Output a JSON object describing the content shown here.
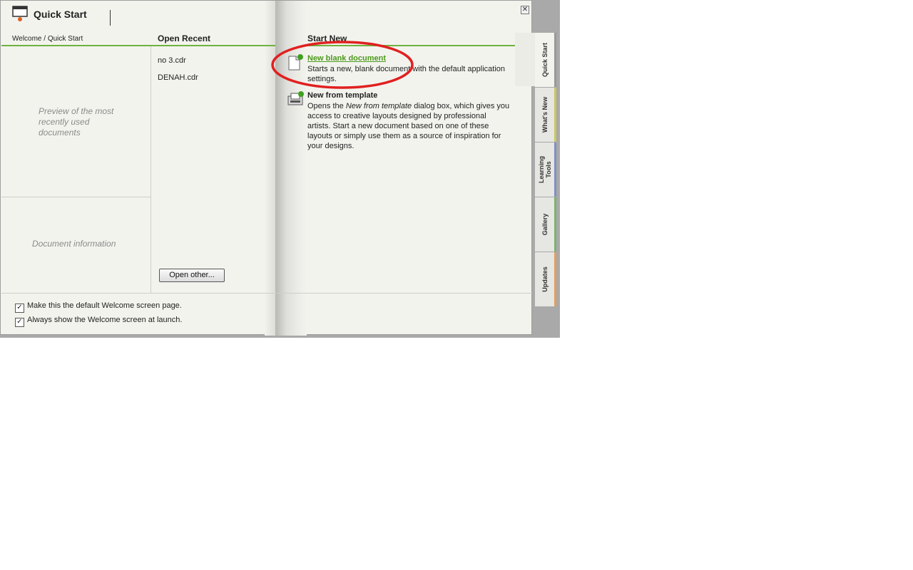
{
  "window": {
    "title": "Quick Start",
    "close_glyph": "✕"
  },
  "breadcrumb": "Welcome / Quick Start",
  "columns": {
    "open_recent": "Open Recent",
    "start_new": "Start New"
  },
  "left_pane": {
    "preview_text": "Preview of the most recently used documents",
    "docinfo_text": "Document information"
  },
  "recent_files": [
    "no 3.cdr",
    "DENAH.cdr"
  ],
  "open_other_label": "Open other...",
  "start_new": {
    "items": [
      {
        "title": "New blank document",
        "description": "Starts a new, blank document with the default application settings.",
        "icon": "blank-document-icon"
      },
      {
        "title": "New from template",
        "desc_pre": "Opens the ",
        "desc_em": "New from template",
        "desc_post": " dialog box, which gives you access to creative layouts designed by professional artists. Start a new document based on one of these layouts or simply use them as a source of inspiration for your designs.",
        "icon": "template-icon"
      }
    ]
  },
  "checkboxes": [
    {
      "label": "Make this the default Welcome screen page.",
      "checked": true
    },
    {
      "label": "Always show the Welcome screen at launch.",
      "checked": true
    }
  ],
  "tabs": [
    {
      "label": "Quick Start",
      "accent": "#888888",
      "active": true
    },
    {
      "label": "What's New",
      "accent": "#c8c860"
    },
    {
      "label": "Learning Tools",
      "accent": "#8090c0"
    },
    {
      "label": "Gallery",
      "accent": "#80b070"
    },
    {
      "label": "Updates",
      "accent": "#e0a060"
    }
  ],
  "colors": {
    "link_green": "#4c9a1c",
    "rule_green": "#6db33f",
    "annotation_red": "#e02020"
  }
}
